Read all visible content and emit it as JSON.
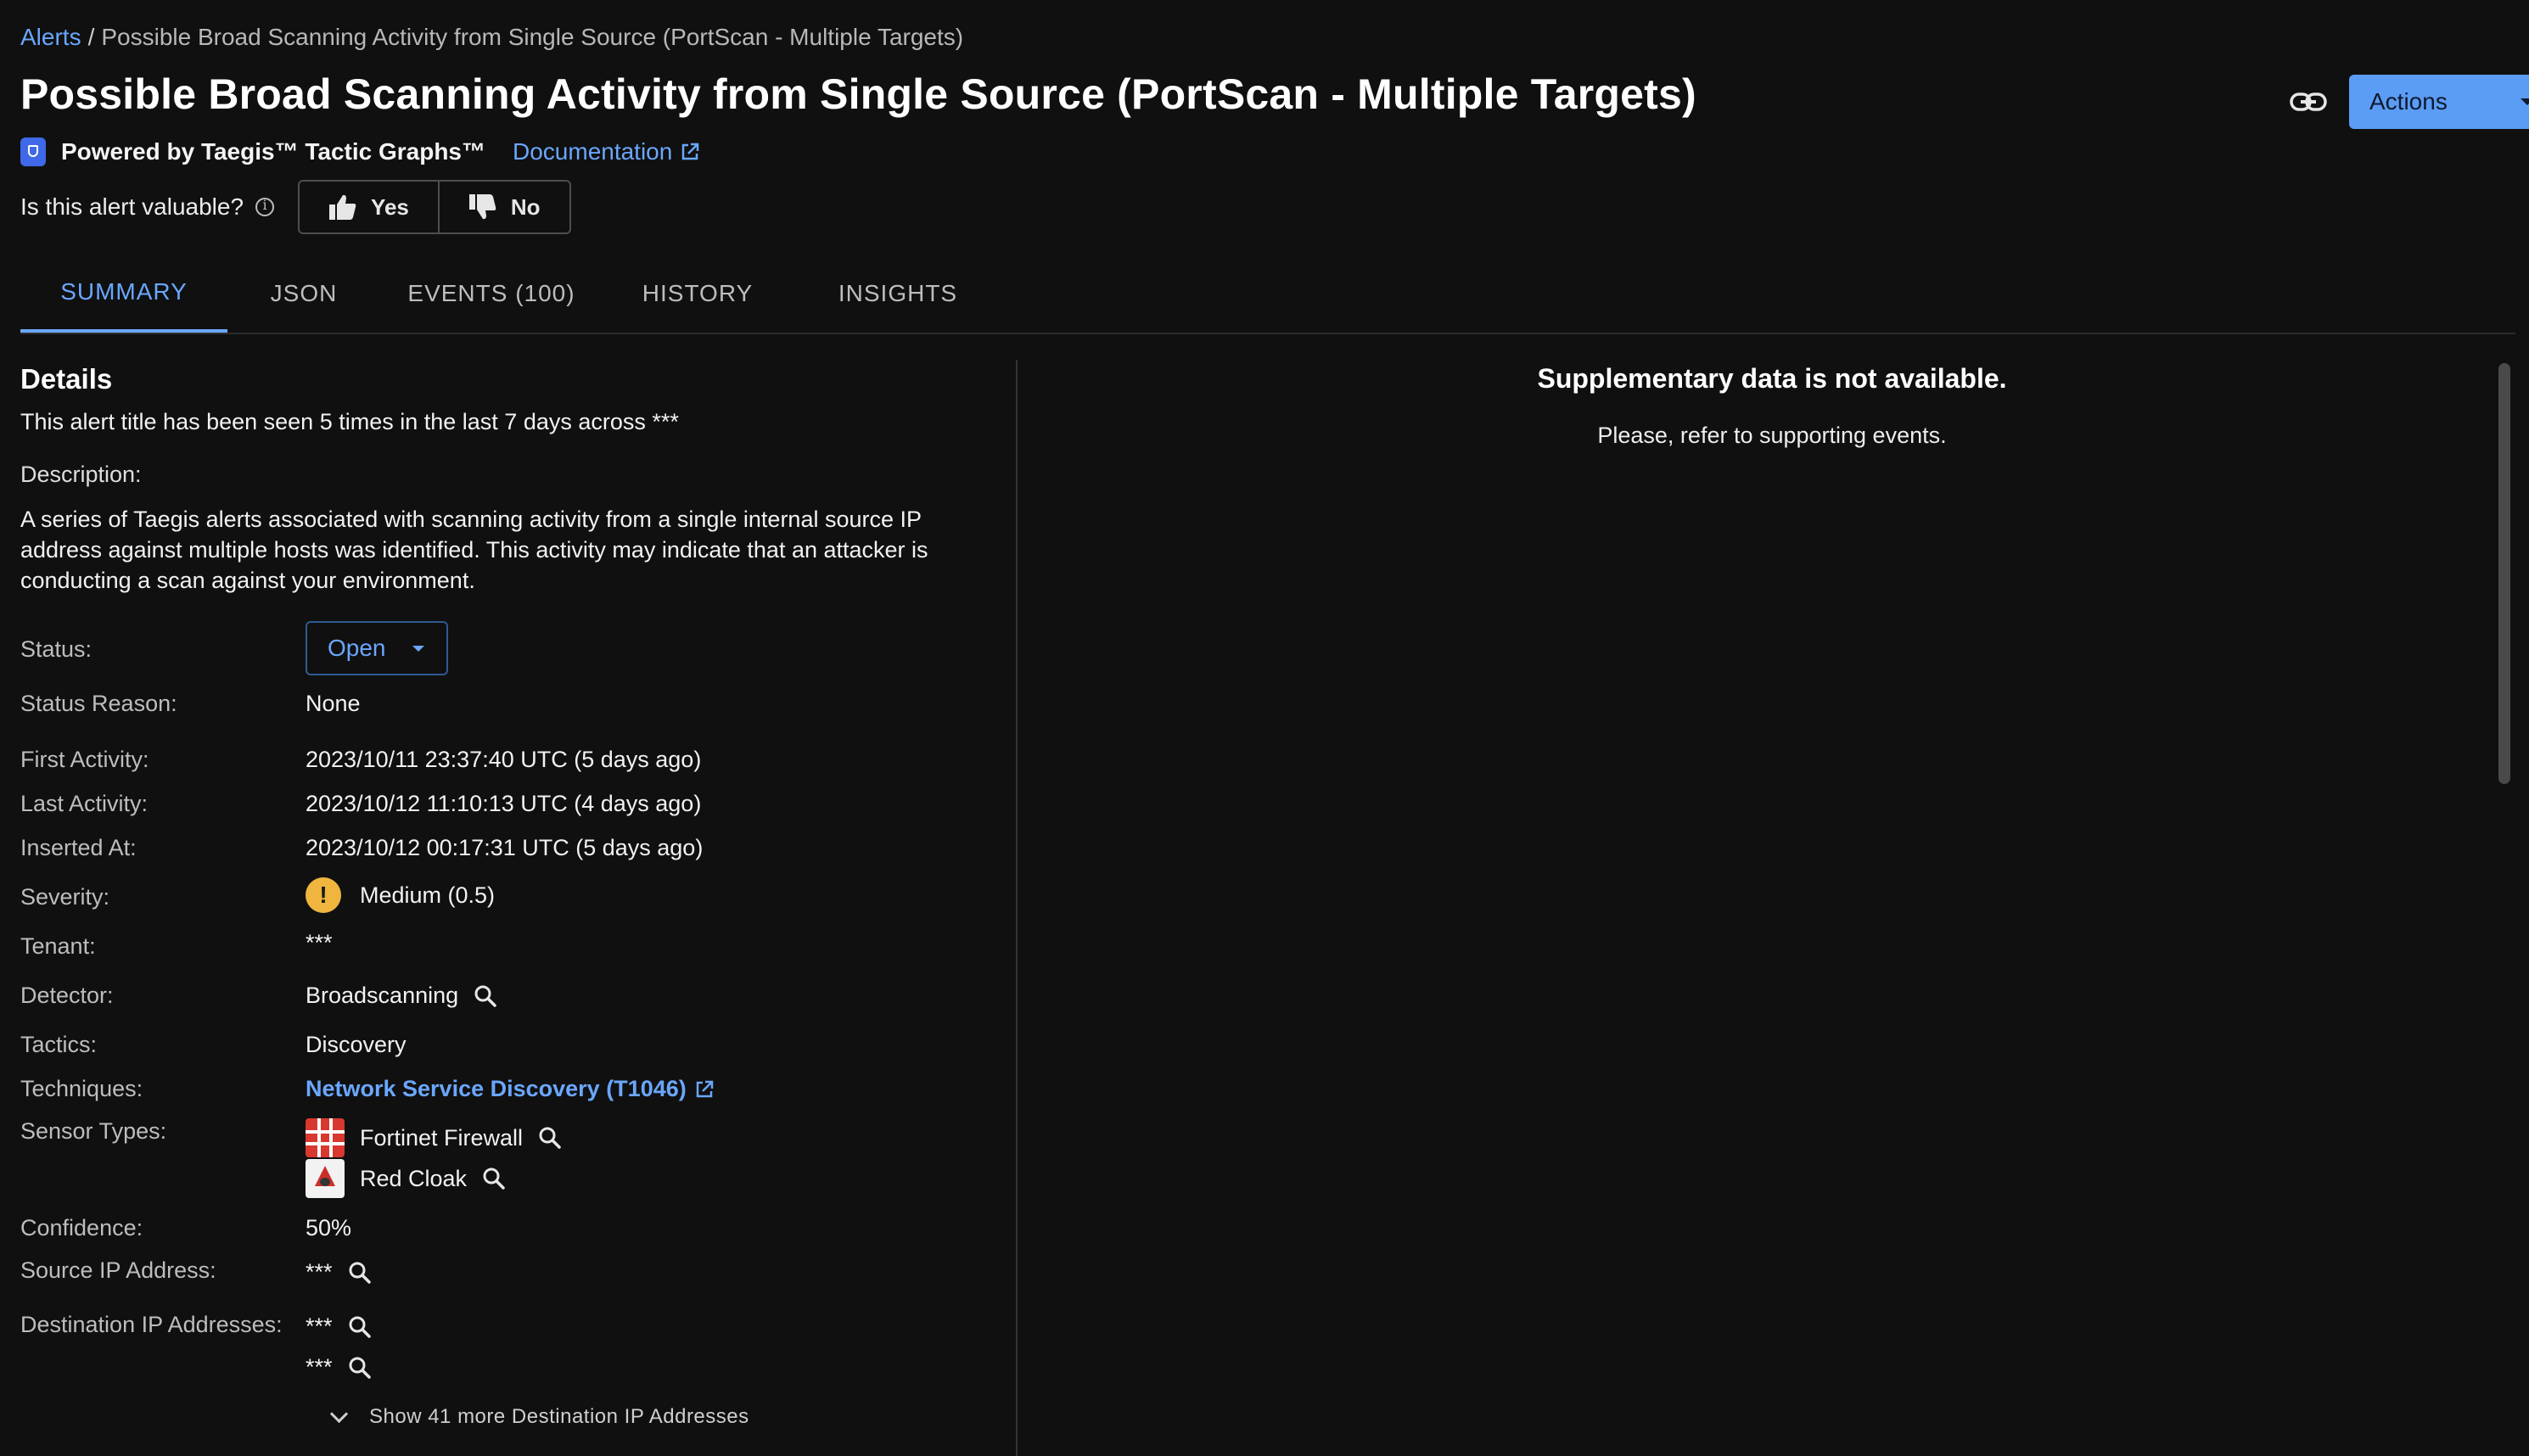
{
  "breadcrumb": {
    "root": "Alerts",
    "separator": "/",
    "current": "Possible Broad Scanning Activity from Single Source (PortScan - Multiple Targets)"
  },
  "title": "Possible Broad Scanning Activity from Single Source (PortScan - Multiple Targets)",
  "header": {
    "actions_label": "Actions"
  },
  "powered_by": {
    "text": "Powered by Taegis™ Tactic Graphs™",
    "doc_link": "Documentation"
  },
  "feedback": {
    "question": "Is this alert valuable?",
    "yes": "Yes",
    "no": "No"
  },
  "tabs": [
    {
      "label": "SUMMARY",
      "active": true
    },
    {
      "label": "JSON"
    },
    {
      "label": "EVENTS (100)"
    },
    {
      "label": "HISTORY"
    },
    {
      "label": "INSIGHTS"
    }
  ],
  "details": {
    "heading": "Details",
    "seen_text": "This alert title has been seen 5 times in the last 7 days across ***",
    "description_label": "Description:",
    "description": "A series of Taegis alerts associated with scanning activity from a single internal source IP address against multiple hosts was identified. This activity may indicate that an attacker is conducting a scan against your environment.",
    "fields": {
      "status": {
        "label": "Status:",
        "value": "Open"
      },
      "status_reason": {
        "label": "Status Reason:",
        "value": "None"
      },
      "first_activity": {
        "label": "First Activity:",
        "value": "2023/10/11 23:37:40 UTC (5 days ago)"
      },
      "last_activity": {
        "label": "Last Activity:",
        "value": "2023/10/12 11:10:13 UTC (4 days ago)"
      },
      "inserted_at": {
        "label": "Inserted At:",
        "value": "2023/10/12 00:17:31 UTC (5 days ago)"
      },
      "severity": {
        "label": "Severity:",
        "value": "Medium (0.5)",
        "icon": "!",
        "color": "#f0b53e"
      },
      "tenant": {
        "label": "Tenant:",
        "value": "***"
      },
      "detector": {
        "label": "Detector:",
        "value": "Broadscanning"
      },
      "tactics": {
        "label": "Tactics:",
        "value": "Discovery"
      },
      "techniques": {
        "label": "Techniques:",
        "value": "Network Service Discovery (T1046)"
      },
      "sensor_types": {
        "label": "Sensor Types:",
        "values": [
          "Fortinet Firewall",
          "Red Cloak"
        ]
      },
      "confidence": {
        "label": "Confidence:",
        "value": "50%"
      },
      "source_ip": {
        "label": "Source IP Address:",
        "value": "***"
      },
      "destination_ips": {
        "label": "Destination IP Addresses:",
        "values": [
          "***",
          "***"
        ],
        "show_more": "Show 41 more Destination IP Addresses"
      }
    }
  },
  "supplementary": {
    "title": "Supplementary data is not available.",
    "subtitle": "Please, refer to supporting events."
  },
  "colors": {
    "accent": "#6aa7ff",
    "button": "#5b9cf5",
    "background": "#101010"
  }
}
